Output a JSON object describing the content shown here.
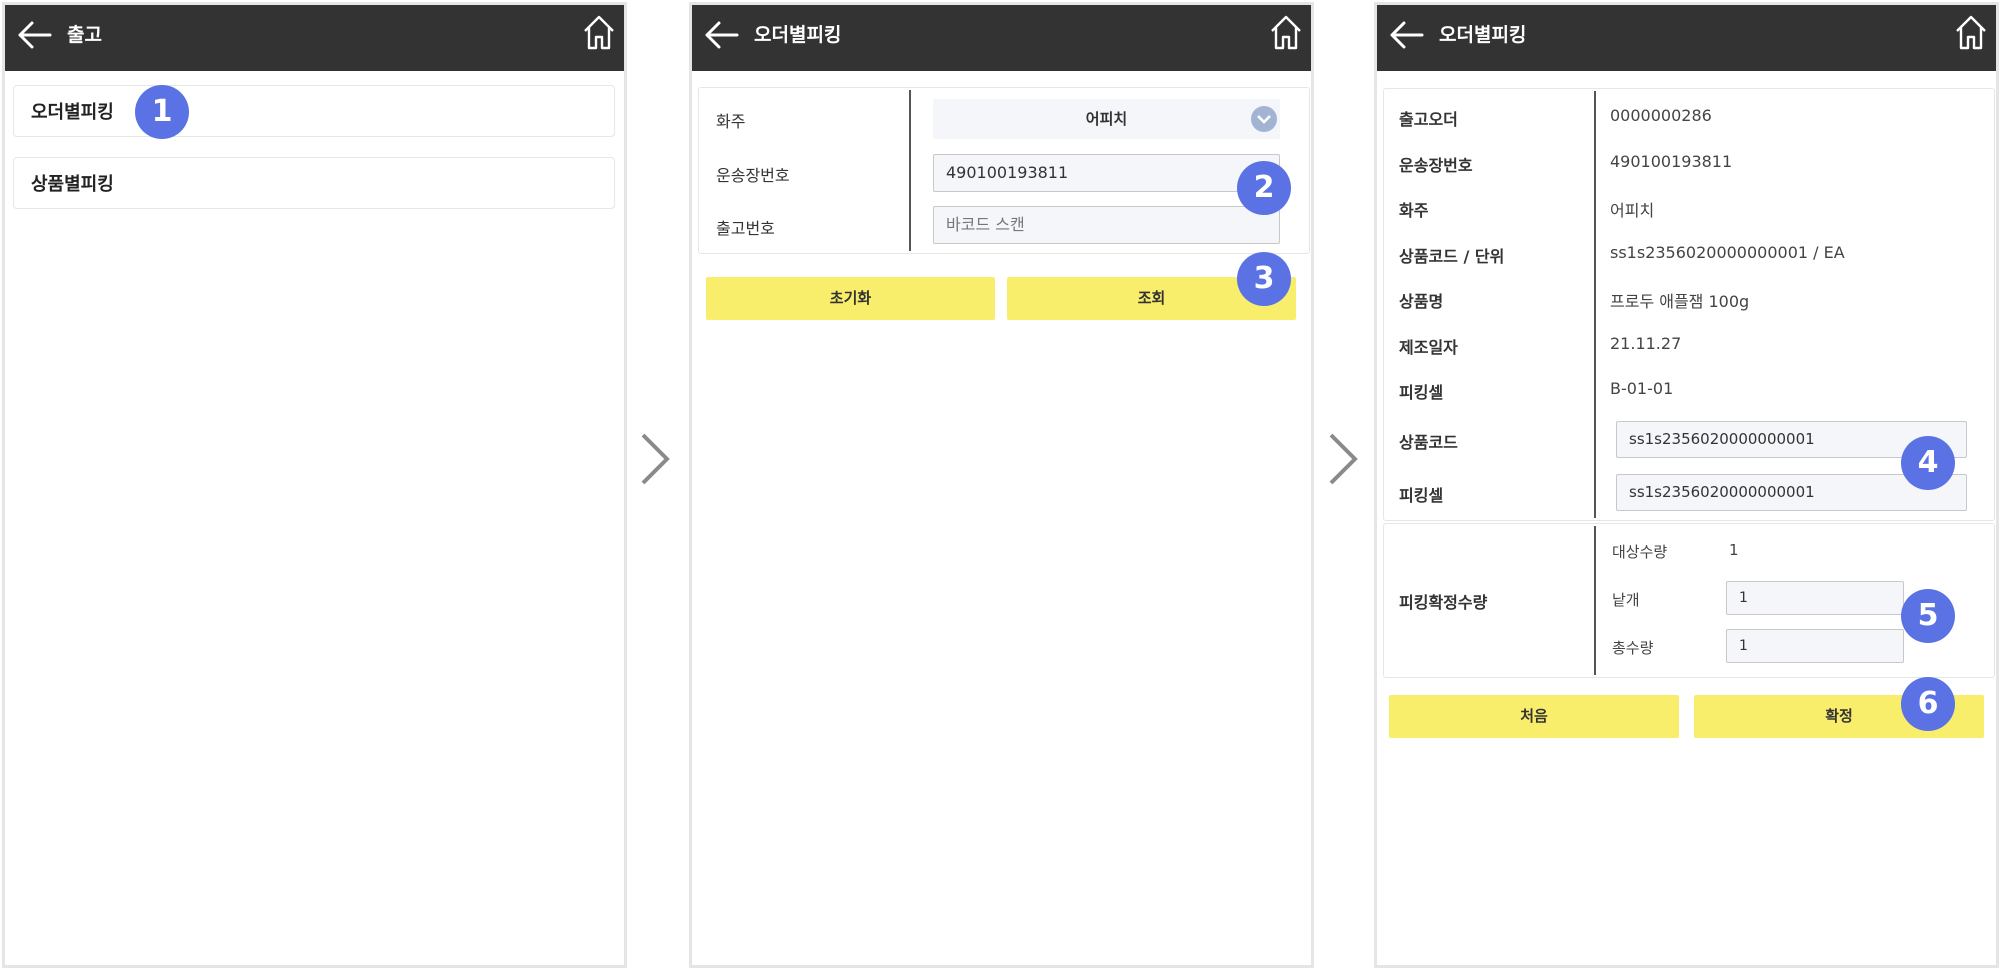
{
  "screen1": {
    "title": "출고",
    "menu": [
      {
        "label": "오더별피킹"
      },
      {
        "label": "상품별피킹"
      }
    ]
  },
  "screen2": {
    "title": "오더별피킹",
    "form": {
      "owner_label": "화주",
      "owner_value": "어피치",
      "waybill_label": "운송장번호",
      "waybill_value": "490100193811",
      "outbound_label": "출고번호",
      "outbound_placeholder": "바코드 스캔"
    },
    "buttons": {
      "reset": "초기화",
      "search": "조회"
    }
  },
  "screen3": {
    "title": "오더별피킹",
    "details": [
      {
        "label": "출고오더",
        "value": "0000000286"
      },
      {
        "label": "운송장번호",
        "value": "490100193811"
      },
      {
        "label": "화주",
        "value": "어피치"
      },
      {
        "label": "상품코드 / 단위",
        "value": "ss1s2356020000000001 / EA"
      },
      {
        "label": "상품명",
        "value": "프로두 애플잼 100g"
      },
      {
        "label": "제조일자",
        "value": "21.11.27"
      },
      {
        "label": "피킹셀",
        "value": "B-01-01"
      }
    ],
    "scan": {
      "product_code_label": "상품코드",
      "product_code_value": "ss1s2356020000000001",
      "picking_cell_label": "피킹셀",
      "picking_cell_value": "ss1s2356020000000001"
    },
    "qty": {
      "section_label": "피킹확정수량",
      "target_label": "대상수량",
      "target_value": "1",
      "each_label": "낱개",
      "each_value": "1",
      "total_label": "총수량",
      "total_value": "1"
    },
    "buttons": {
      "first": "처음",
      "confirm": "확정"
    }
  },
  "badges": [
    "1",
    "2",
    "3",
    "4",
    "5",
    "6"
  ],
  "colors": {
    "header": "#333333",
    "button": "#f9ee6c",
    "badge": "#5b72e5",
    "select_chevron": "#a3b3d2"
  }
}
